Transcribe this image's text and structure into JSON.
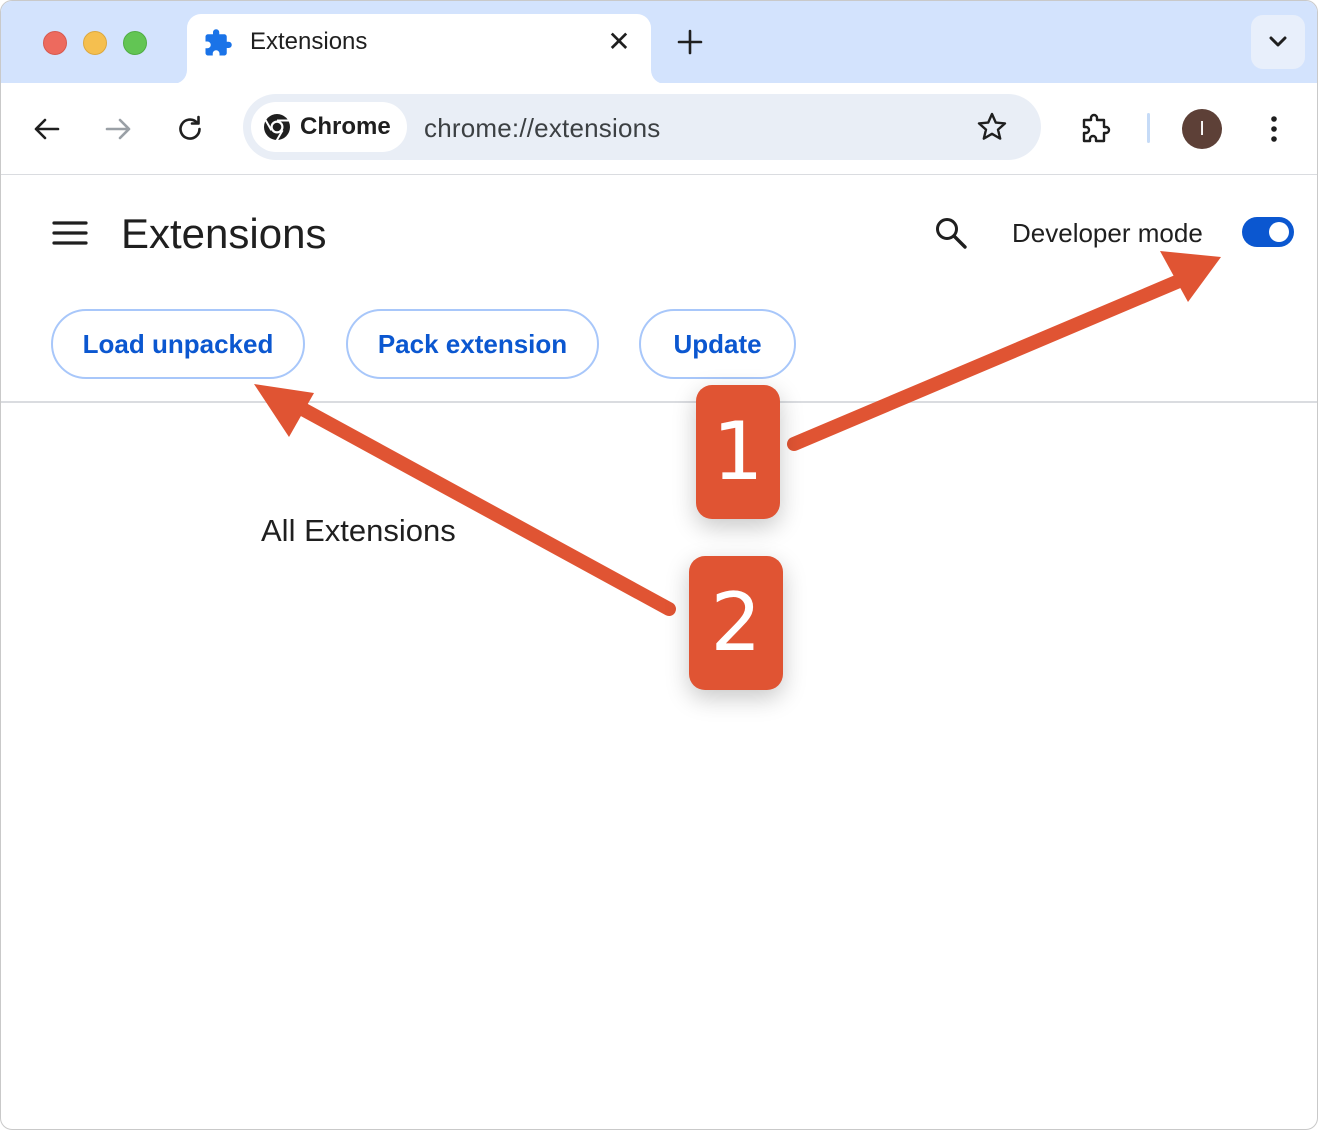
{
  "browser": {
    "tab": {
      "title": "Extensions",
      "icon": "puzzle-icon",
      "close_symbol": "✕"
    },
    "toolbar": {
      "chip_label": "Chrome",
      "url": "chrome://extensions",
      "avatar_initial": "I"
    }
  },
  "page": {
    "title": "Extensions",
    "developer_mode_label": "Developer mode",
    "developer_mode_on": true,
    "buttons": {
      "load_unpacked": "Load unpacked",
      "pack_extension": "Pack extension",
      "update": "Update"
    },
    "section_title": "All Extensions"
  },
  "annotations": {
    "badge_1": "1",
    "badge_2": "2",
    "color": "#e05433"
  },
  "colors": {
    "tabstrip": "#d3e3fd",
    "accent": "#0b57d0",
    "button_border": "#a8c7fa"
  }
}
